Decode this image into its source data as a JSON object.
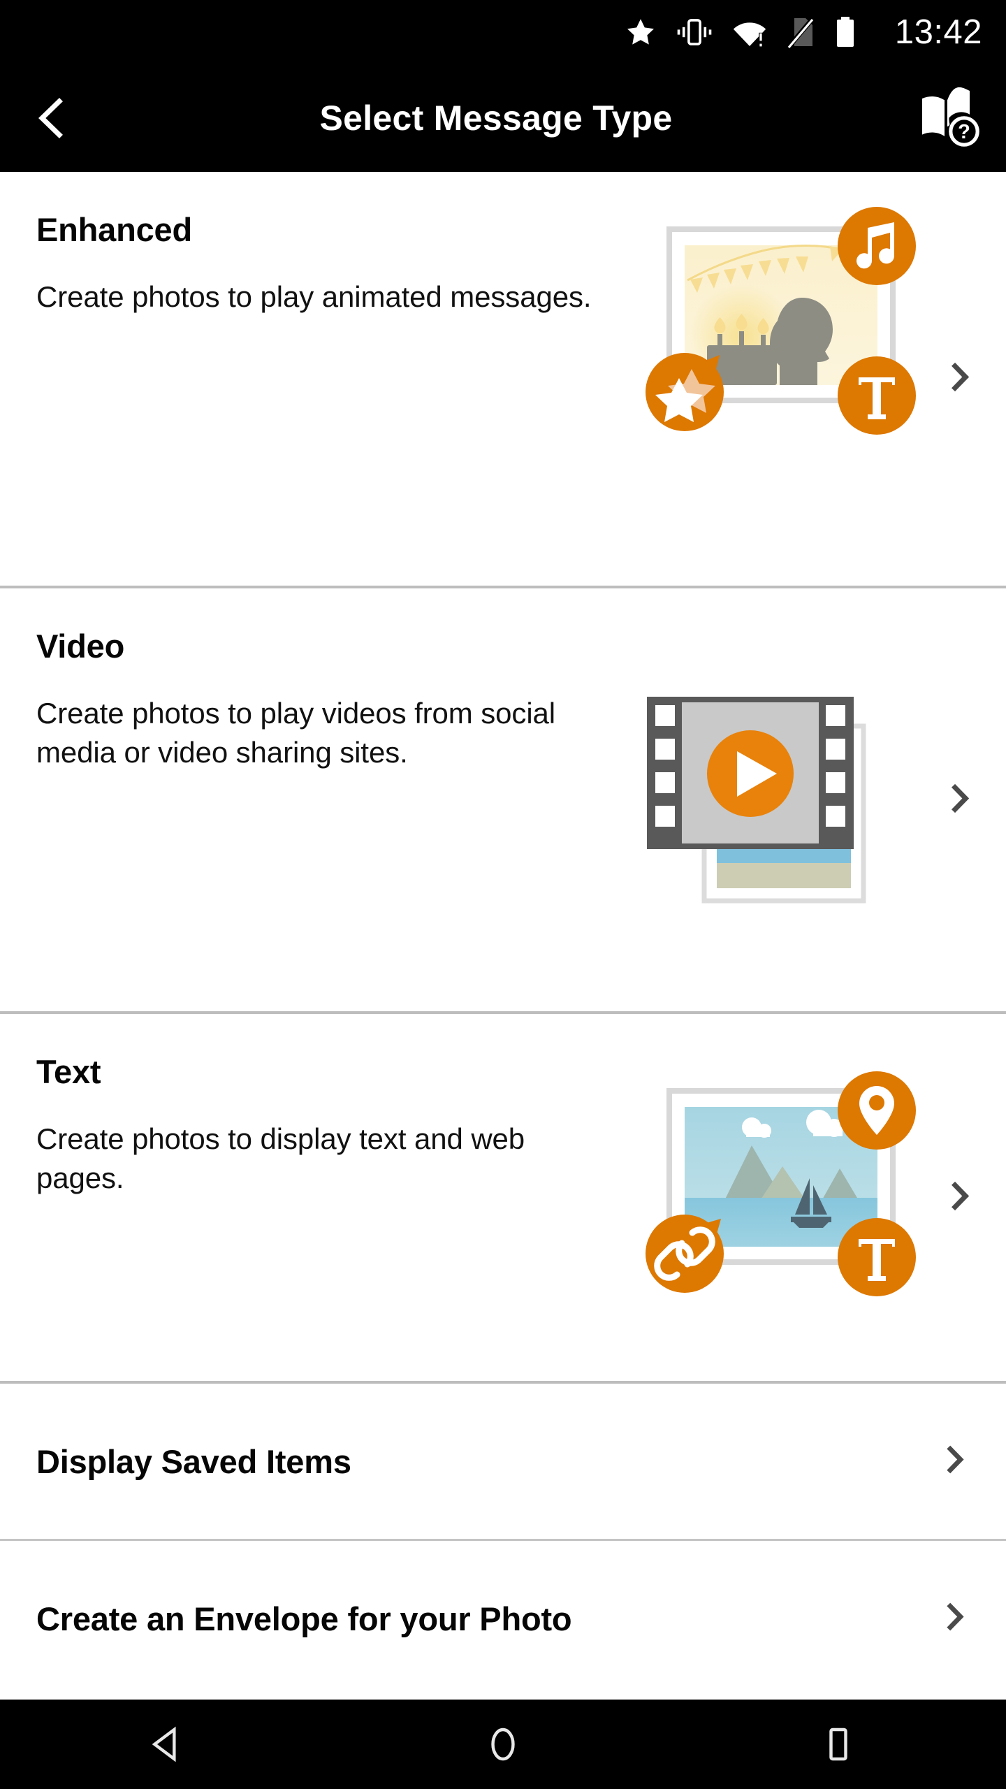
{
  "status_bar": {
    "time": "13:42",
    "icons": [
      "star-icon",
      "vibrate-icon",
      "wifi-warning-icon",
      "no-sim-icon",
      "battery-full-icon"
    ]
  },
  "app_bar": {
    "title": "Select Message Type",
    "back_icon": "chevron-left-icon",
    "help_icon": "manual-help-icon"
  },
  "colors": {
    "accent_orange": "#DD7800",
    "app_bar_bg": "#000000",
    "divider": "#bdbdbd",
    "chevron": "#4a4a4a",
    "text_primary": "#060606"
  },
  "sections": [
    {
      "title": "Enhanced",
      "description": "Create photos to play animated messages.",
      "art": "enhanced-photo-illustration",
      "badges": [
        "music-note-icon",
        "sparkle-stars-icon",
        "text-t-icon"
      ],
      "chevron_icon": "chevron-right-icon"
    },
    {
      "title": "Video",
      "description": "Create photos to play videos from social media or video sharing sites.",
      "art": "video-filmstrip-illustration",
      "badges": [
        "play-icon"
      ],
      "chevron_icon": "chevron-right-icon"
    },
    {
      "title": "Text",
      "description": "Create photos to display text and web pages.",
      "art": "text-landscape-illustration",
      "badges": [
        "location-pin-icon",
        "link-chain-icon",
        "text-t-icon"
      ],
      "chevron_icon": "chevron-right-icon"
    }
  ],
  "rows": [
    {
      "label": "Display Saved Items",
      "chevron_icon": "chevron-right-icon"
    },
    {
      "label": "Create an Envelope for your Photo",
      "chevron_icon": "chevron-right-icon"
    }
  ],
  "nav_bar": {
    "back": "nav-back-triangle-icon",
    "home": "nav-home-circle-icon",
    "recents": "nav-recents-square-icon"
  }
}
